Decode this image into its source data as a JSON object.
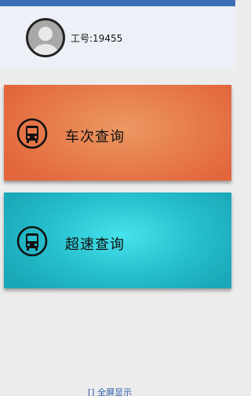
{
  "header": {
    "employee_label": "工号:19455"
  },
  "cards": [
    {
      "label": "车次查询",
      "icon": "bus-icon",
      "color": "#e77b4c"
    },
    {
      "label": "超速查询",
      "icon": "bus-icon",
      "color": "#26bfcc"
    }
  ],
  "footer": {
    "label": "[] 全屏显示"
  },
  "colors": {
    "top_strip": "#3b6fb6",
    "header_bg": "#edf0f6",
    "page_bg": "#ececec"
  }
}
